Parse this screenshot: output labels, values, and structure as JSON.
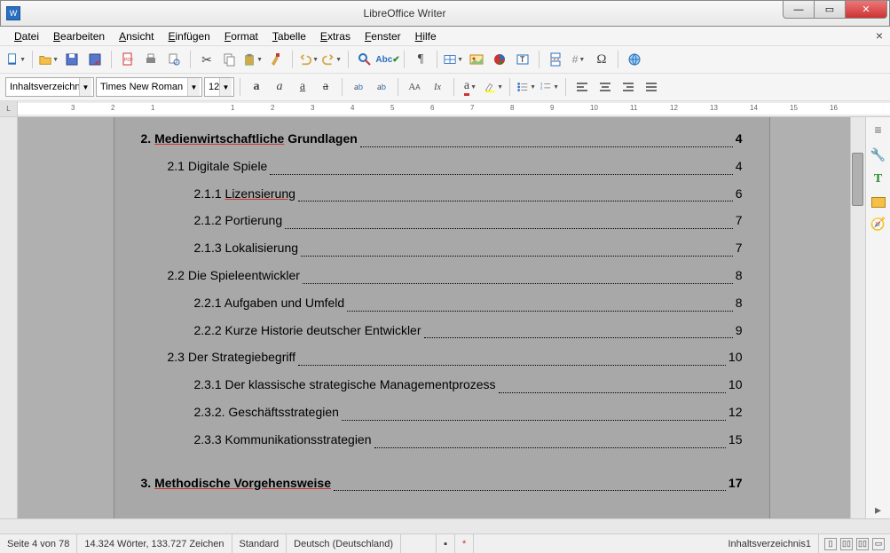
{
  "window": {
    "title": "LibreOffice Writer"
  },
  "menu": {
    "items": [
      {
        "label": "Datei",
        "u": "D"
      },
      {
        "label": "Bearbeiten",
        "u": "B"
      },
      {
        "label": "Ansicht",
        "u": "A"
      },
      {
        "label": "Einfügen",
        "u": "E"
      },
      {
        "label": "Format",
        "u": "F"
      },
      {
        "label": "Tabelle",
        "u": "T"
      },
      {
        "label": "Extras",
        "u": "E"
      },
      {
        "label": "Fenster",
        "u": "F"
      },
      {
        "label": "Hilfe",
        "u": "H"
      }
    ]
  },
  "format": {
    "style": "Inhaltsverzeichnis",
    "font": "Times New Roman",
    "size": "12"
  },
  "ruler": {
    "left_label": "L",
    "marks": [
      "3",
      "2",
      "1",
      "",
      "1",
      "2",
      "3",
      "4",
      "5",
      "6",
      "7",
      "8",
      "9",
      "10",
      "11",
      "12",
      "13",
      "14",
      "15",
      "16"
    ]
  },
  "toc": [
    {
      "lvl": 1,
      "num": "2.",
      "text": "Medienwirtschaftliche",
      "rest": " Grundlagen",
      "page": "4",
      "underline": true
    },
    {
      "lvl": 2,
      "num": "2.1",
      "text": "Digitale Spiele",
      "page": "4"
    },
    {
      "lvl": 3,
      "num": "2.1.1",
      "text": "Lizensierung",
      "page": "6",
      "underline": true
    },
    {
      "lvl": 3,
      "num": "2.1.2",
      "text": "Portierung",
      "page": "7"
    },
    {
      "lvl": 3,
      "num": "2.1.3",
      "text": "Lokalisierung",
      "page": "7"
    },
    {
      "lvl": 2,
      "num": "2.2",
      "text": "Die Spieleentwickler",
      "page": "8"
    },
    {
      "lvl": 3,
      "num": "2.2.1",
      "text": "Aufgaben und Umfeld",
      "page": "8"
    },
    {
      "lvl": 3,
      "num": "2.2.2",
      "text": "Kurze Historie deutscher Entwickler",
      "page": "9"
    },
    {
      "lvl": 2,
      "num": "2.3",
      "text": "Der Strategiebegriff",
      "page": "10"
    },
    {
      "lvl": 3,
      "num": "2.3.1",
      "text": "Der klassische strategische Managementprozess",
      "page": "10"
    },
    {
      "lvl": 3,
      "num": "2.3.2.",
      "text": "Geschäftsstrategien",
      "page": "12"
    },
    {
      "lvl": 3,
      "num": "2.3.3",
      "text": "Kommunikationsstrategien",
      "page": "15"
    },
    {
      "lvl": 1,
      "num": "3.",
      "text": "Methodische Vorgehensweise",
      "page": "17",
      "underline": true
    }
  ],
  "status": {
    "page": "Seite 4 von 78",
    "words": "14.324 Wörter, 133.727 Zeichen",
    "style": "Standard",
    "lang": "Deutsch (Deutschland)",
    "context": "Inhaltsverzeichnis1"
  }
}
